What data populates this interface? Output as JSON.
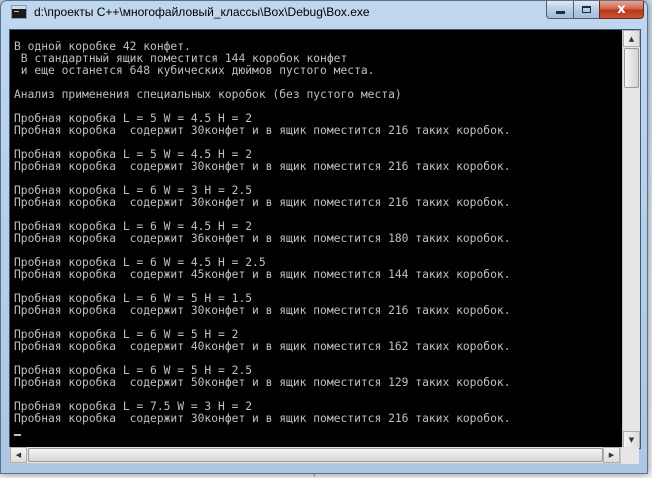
{
  "window": {
    "title": "d:\\проекты C++\\многофайловый_классы\\Box\\Debug\\Box.exe",
    "icon": "console-app-icon",
    "close_glyph": "x"
  },
  "console": {
    "lines": [
      "В одной коробке 42 конфет.",
      " В стандартный ящик поместится 144 коробок конфет",
      " и еще останется 648 кубических дюймов пустого места.",
      "",
      "Анализ применения специальных коробок (без пустого места)",
      "",
      "Пробная коробка L = 5 W = 4.5 H = 2",
      "Пробная коробка  содержит 30конфет и в ящик поместится 216 таких коробок.",
      "",
      "Пробная коробка L = 5 W = 4.5 H = 2",
      "Пробная коробка  содержит 30конфет и в ящик поместится 216 таких коробок.",
      "",
      "Пробная коробка L = 6 W = 3 H = 2.5",
      "Пробная коробка  содержит 30конфет и в ящик поместится 216 таких коробок.",
      "",
      "Пробная коробка L = 6 W = 4.5 H = 2",
      "Пробная коробка  содержит 36конфет и в ящик поместится 180 таких коробок.",
      "",
      "Пробная коробка L = 6 W = 4.5 H = 2.5",
      "Пробная коробка  содержит 45конфет и в ящик поместится 144 таких коробок.",
      "",
      "Пробная коробка L = 6 W = 5 H = 1.5",
      "Пробная коробка  содержит 30конфет и в ящик поместится 216 таких коробок.",
      "",
      "Пробная коробка L = 6 W = 5 H = 2",
      "Пробная коробка  содержит 40конфет и в ящик поместится 162 таких коробок.",
      "",
      "Пробная коробка L = 6 W = 5 H = 2.5",
      "Пробная коробка  содержит 50конфет и в ящик поместится 129 таких коробок.",
      "",
      "Пробная коробка L = 7.5 W = 3 H = 2",
      "Пробная коробка  содержит 30конфет и в ящик поместится 216 таких коробок."
    ]
  },
  "backdrop": {
    "partial_text": "конфет"
  },
  "colors": {
    "console_bg": "#000000",
    "console_fg": "#c0c0c0",
    "close_button": "#c9553a"
  }
}
